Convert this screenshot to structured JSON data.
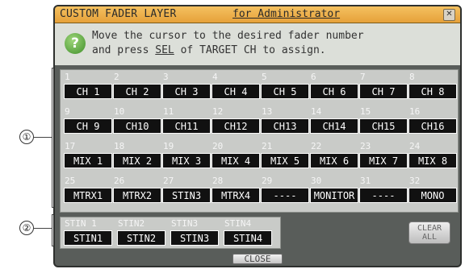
{
  "callouts": [
    "①",
    "②"
  ],
  "window": {
    "title": "CUSTOM FADER LAYER",
    "subtitle": "for Administrator",
    "close_glyph": "✕"
  },
  "help": {
    "icon": "question-icon",
    "glyph": "?",
    "line1": "Move the cursor to the desired fader number",
    "line2_a": "and press ",
    "line2_sel": "SEL",
    "line2_b": " of TARGET CH to assign."
  },
  "faders": [
    {
      "num": "1",
      "label": "CH 1"
    },
    {
      "num": "2",
      "label": "CH 2"
    },
    {
      "num": "3",
      "label": "CH 3"
    },
    {
      "num": "4",
      "label": "CH 4"
    },
    {
      "num": "5",
      "label": "CH 5"
    },
    {
      "num": "6",
      "label": "CH 6"
    },
    {
      "num": "7",
      "label": "CH 7"
    },
    {
      "num": "8",
      "label": "CH 8"
    },
    {
      "num": "9",
      "label": "CH 9"
    },
    {
      "num": "10",
      "label": "CH10"
    },
    {
      "num": "11",
      "label": "CH11"
    },
    {
      "num": "12",
      "label": "CH12"
    },
    {
      "num": "13",
      "label": "CH13"
    },
    {
      "num": "14",
      "label": "CH14"
    },
    {
      "num": "15",
      "label": "CH15"
    },
    {
      "num": "16",
      "label": "CH16"
    },
    {
      "num": "17",
      "label": "MIX 1"
    },
    {
      "num": "18",
      "label": "MIX 2"
    },
    {
      "num": "19",
      "label": "MIX 3"
    },
    {
      "num": "20",
      "label": "MIX 4"
    },
    {
      "num": "21",
      "label": "MIX 5"
    },
    {
      "num": "22",
      "label": "MIX 6"
    },
    {
      "num": "23",
      "label": "MIX 7"
    },
    {
      "num": "24",
      "label": "MIX 8"
    },
    {
      "num": "25",
      "label": "MTRX1"
    },
    {
      "num": "26",
      "label": "MTRX2"
    },
    {
      "num": "27",
      "label": "STIN3"
    },
    {
      "num": "28",
      "label": "MTRX4"
    },
    {
      "num": "29",
      "label": "----"
    },
    {
      "num": "30",
      "label": "MONITOR"
    },
    {
      "num": "31",
      "label": "----"
    },
    {
      "num": "32",
      "label": "MONO"
    }
  ],
  "stin": [
    {
      "num": "STIN 1",
      "label": "STIN1"
    },
    {
      "num": "STIN2",
      "label": "STIN2"
    },
    {
      "num": "STIN3",
      "label": "STIN3"
    },
    {
      "num": "STIN4",
      "label": "STIN4"
    }
  ],
  "clear": {
    "line1": "CLEAR",
    "line2": "ALL"
  },
  "close_label": "CLOSE"
}
